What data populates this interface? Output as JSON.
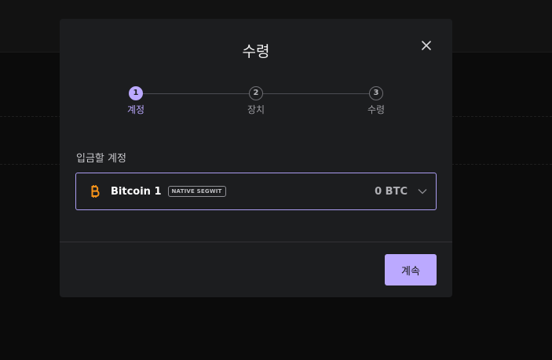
{
  "modal": {
    "title": "수령",
    "close_icon": "close-icon"
  },
  "stepper": {
    "steps": [
      {
        "number": "1",
        "label": "계정",
        "state": "active"
      },
      {
        "number": "2",
        "label": "장치",
        "state": "pending"
      },
      {
        "number": "3",
        "label": "수령",
        "state": "pending"
      }
    ]
  },
  "account_field": {
    "label": "입금할 계정",
    "selected": {
      "icon": "bitcoin-icon",
      "name": "Bitcoin 1",
      "badge": "NATIVE SEGWIT",
      "balance": "0 BTC"
    },
    "dropdown_icon": "chevron-down-icon"
  },
  "footer": {
    "continue_label": "계속"
  },
  "colors": {
    "accent": "#bba9ff",
    "modal_bg": "#1c1d1f",
    "bitcoin": "#f7931a"
  }
}
